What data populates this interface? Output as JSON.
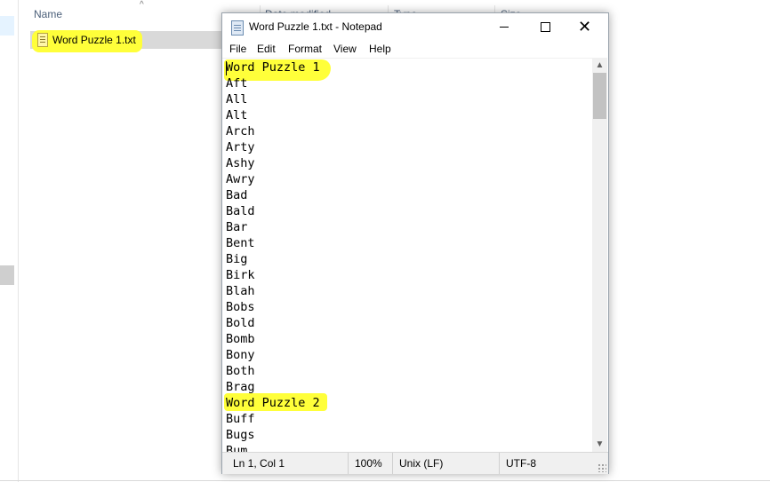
{
  "explorer": {
    "columns": [
      "Name",
      "Date modified",
      "Type",
      "Size"
    ],
    "file_name": "Word Puzzle 1.txt"
  },
  "notepad": {
    "title": "Word Puzzle 1.txt - Notepad",
    "menu": [
      "File",
      "Edit",
      "Format",
      "View",
      "Help"
    ],
    "lines": [
      "Word Puzzle 1",
      "Aft",
      "All",
      "Alt",
      "Arch",
      "Arty",
      "Ashy",
      "Awry",
      "Bad",
      "Bald",
      "Bar",
      "Bent",
      "Big",
      "Birk",
      "Blah",
      "Bobs",
      "Bold",
      "Bomb",
      "Bony",
      "Both",
      "Brag",
      "Word Puzzle 2",
      "Buff",
      "Bugs",
      "Bum"
    ],
    "status": {
      "position": "Ln 1, Col 1",
      "zoom": "100%",
      "line_ending": "Unix (LF)",
      "encoding": "UTF-8"
    }
  },
  "colors": {
    "highlight": "#ffff3a",
    "selection": "#d9d9d9"
  }
}
